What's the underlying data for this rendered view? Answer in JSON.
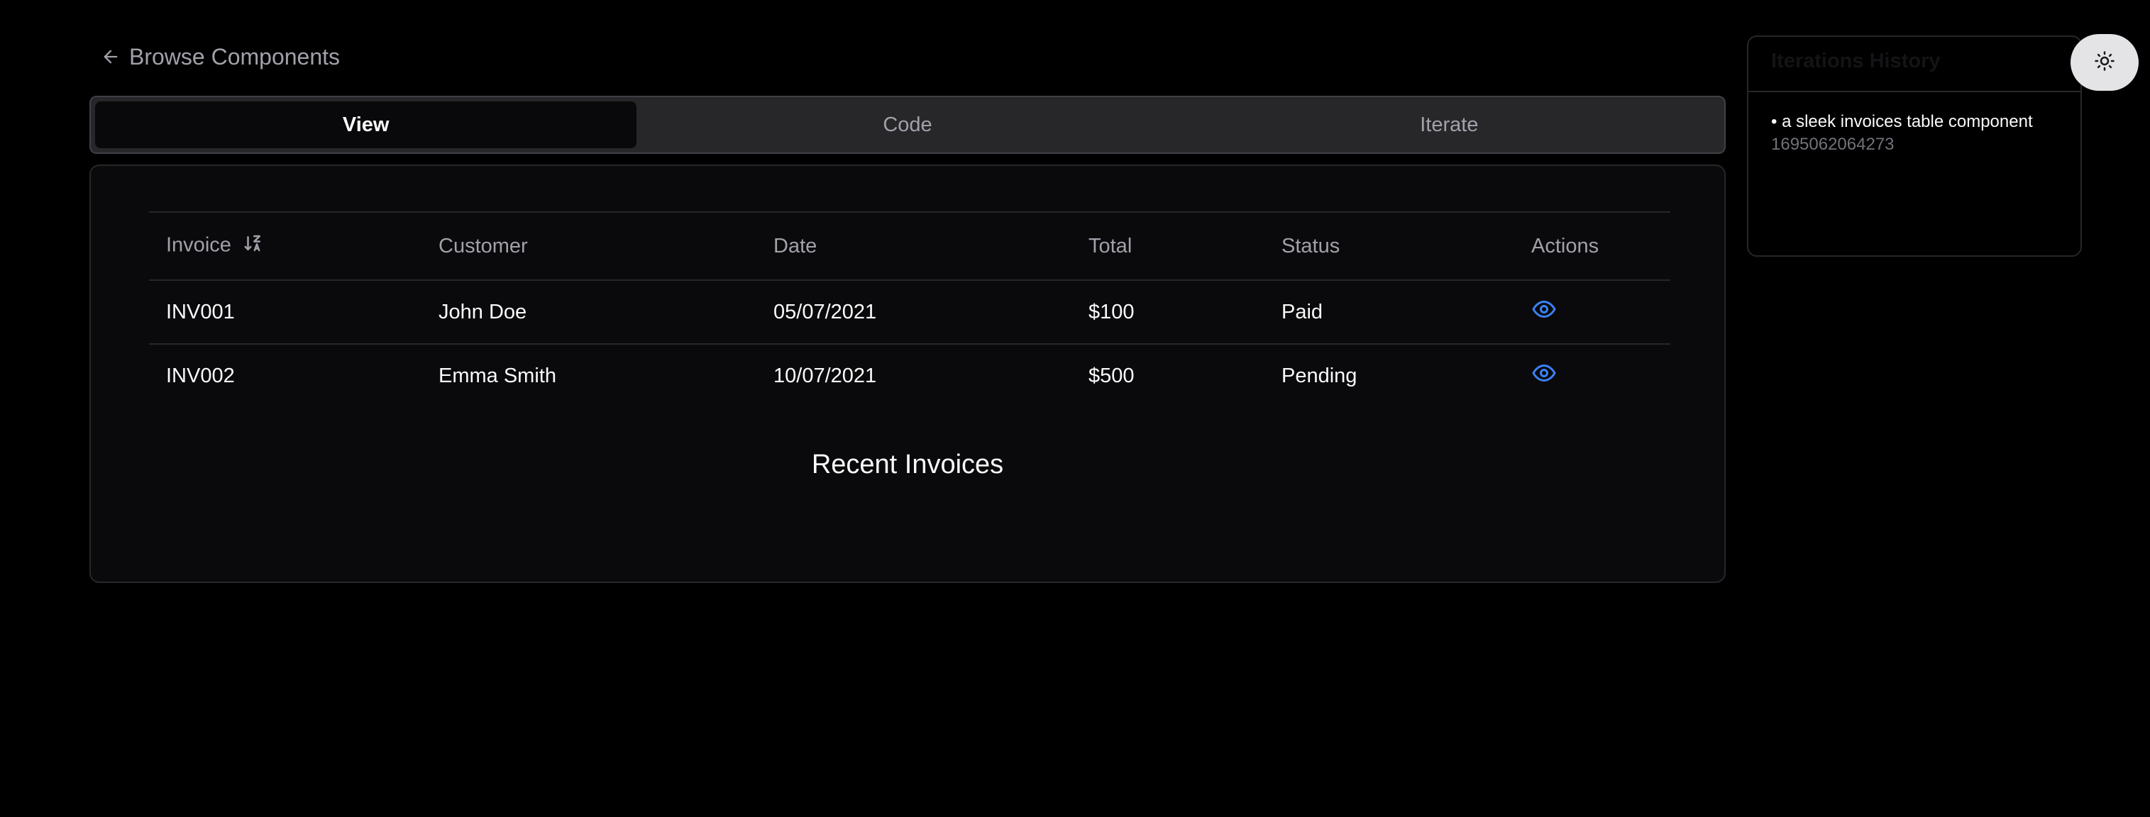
{
  "nav": {
    "back_label": "Browse Components"
  },
  "tabs": [
    {
      "label": "View",
      "active": true
    },
    {
      "label": "Code",
      "active": false
    },
    {
      "label": "Iterate",
      "active": false
    }
  ],
  "table": {
    "columns": [
      "Invoice",
      "Customer",
      "Date",
      "Total",
      "Status",
      "Actions"
    ],
    "rows": [
      {
        "invoice": "INV001",
        "customer": "John Doe",
        "date": "05/07/2021",
        "total": "$100",
        "status": "Paid",
        "action_icon": "eye-icon"
      },
      {
        "invoice": "INV002",
        "customer": "Emma Smith",
        "date": "10/07/2021",
        "total": "$500",
        "status": "Pending",
        "action_icon": "eye-icon"
      }
    ],
    "caption": "Recent Invoices",
    "sort_icon": "sort-z-a-icon"
  },
  "history": {
    "title": "Iterations History",
    "items": [
      {
        "prompt": "• a sleek invoices table component",
        "timestamp": "1695062064273"
      }
    ]
  },
  "theme_toggle": {
    "icon": "sun-icon"
  },
  "colors": {
    "background": "#000000",
    "accent_eye": "#3b82f6",
    "muted_text": "#a1a1aa"
  }
}
